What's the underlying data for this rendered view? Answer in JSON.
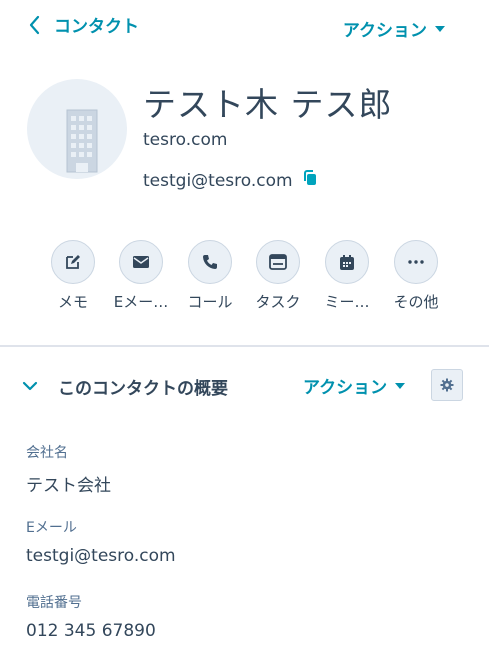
{
  "header": {
    "back_label": "コンタクト",
    "actions_label": "アクション"
  },
  "profile": {
    "name": "テスト木 テス郎",
    "domain": "tesro.com",
    "email": "testgi@tesro.com"
  },
  "quick_actions": [
    {
      "label": "メモ",
      "icon": "pencil-icon"
    },
    {
      "label": "Eメー…",
      "icon": "envelope-icon"
    },
    {
      "label": "コール",
      "icon": "phone-icon"
    },
    {
      "label": "タスク",
      "icon": "task-icon"
    },
    {
      "label": "ミー…",
      "icon": "calendar-icon"
    },
    {
      "label": "その他",
      "icon": "more-icon"
    }
  ],
  "about": {
    "title": "このコンタクトの概要",
    "actions_label": "アクション",
    "fields": [
      {
        "label": "会社名",
        "value": "テスト会社"
      },
      {
        "label": "Eメール",
        "value": "testgi@tesro.com"
      },
      {
        "label": "電話番号",
        "value": "012 345 67890"
      }
    ]
  },
  "colors": {
    "accent": "#0091ae",
    "text": "#33475b",
    "muted": "#516f90",
    "button_bg": "#eaf0f6",
    "border": "#cbd6e2"
  }
}
